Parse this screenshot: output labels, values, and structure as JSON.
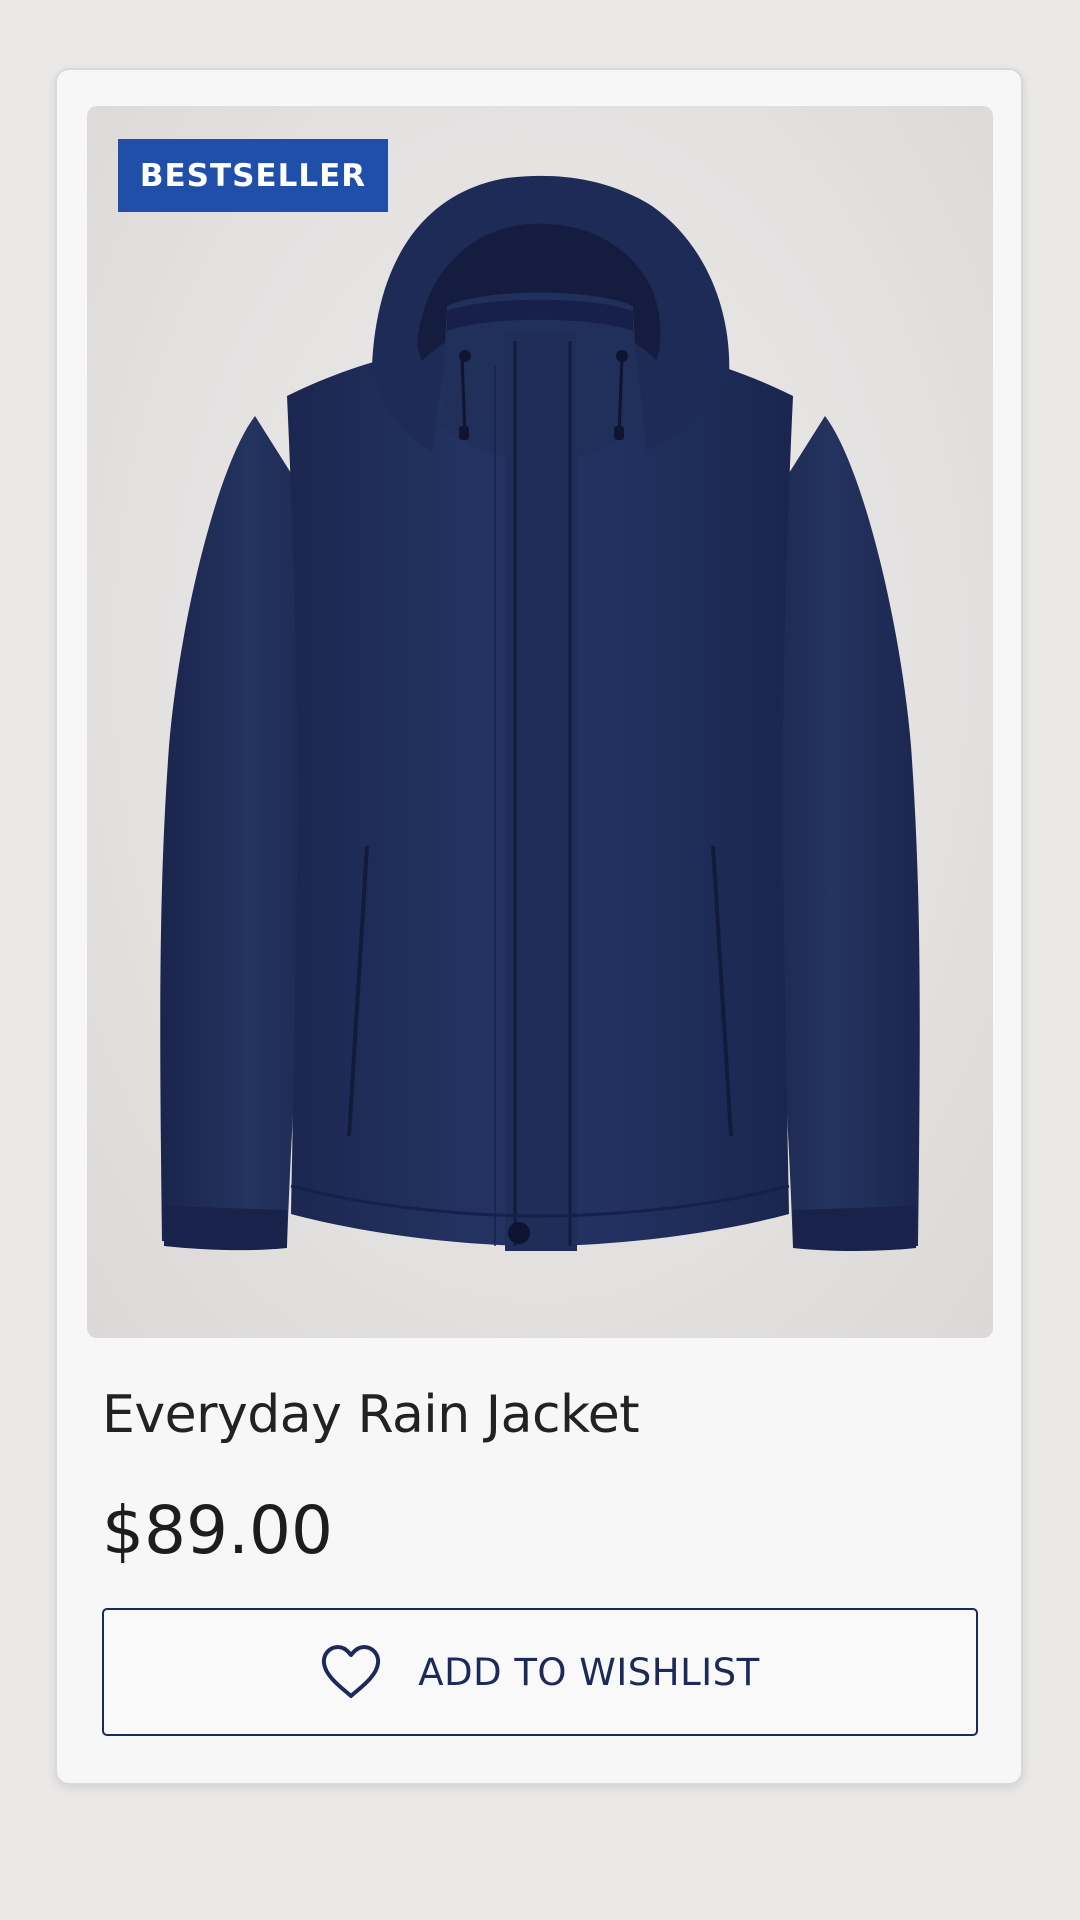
{
  "product": {
    "badge": "BESTSELLER",
    "title": "Everyday Rain Jacket",
    "price": "$89.00",
    "image_icon": "navy-hooded-rain-jacket-photo",
    "jacket_color": "#1f2d58",
    "wishlist": {
      "label": "ADD TO WISHLIST",
      "icon": "heart-outline-icon"
    }
  },
  "colors": {
    "badge_background": "#1f4fa8",
    "button_border": "#1c2a5a",
    "text_primary": "#222222"
  }
}
